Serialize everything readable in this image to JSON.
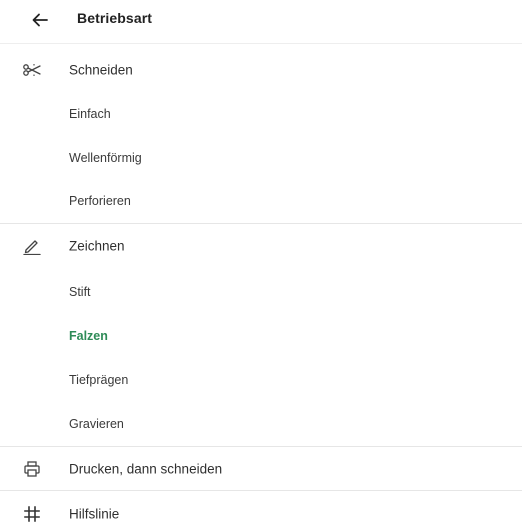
{
  "header": {
    "back_icon": "arrow-left-icon",
    "title": "Betriebsart"
  },
  "sections": {
    "cut": {
      "icon": "scissors-icon",
      "label": "Schneiden",
      "options": [
        "Einfach",
        "Wellenförmig",
        "Perforieren"
      ]
    },
    "draw": {
      "icon": "pencil-icon",
      "label": "Zeichnen",
      "options": [
        "Stift",
        "Falzen",
        "Tiefprägen",
        "Gravieren"
      ],
      "selected": "Falzen"
    },
    "print_then_cut": {
      "icon": "printer-icon",
      "label": "Drucken, dann schneiden"
    },
    "guide": {
      "icon": "hash-grid-icon",
      "label": "Hilfslinie"
    }
  },
  "colors": {
    "selected": "#2e8b57",
    "divider": "#e6e6e6",
    "text": "#2f2f2f"
  }
}
